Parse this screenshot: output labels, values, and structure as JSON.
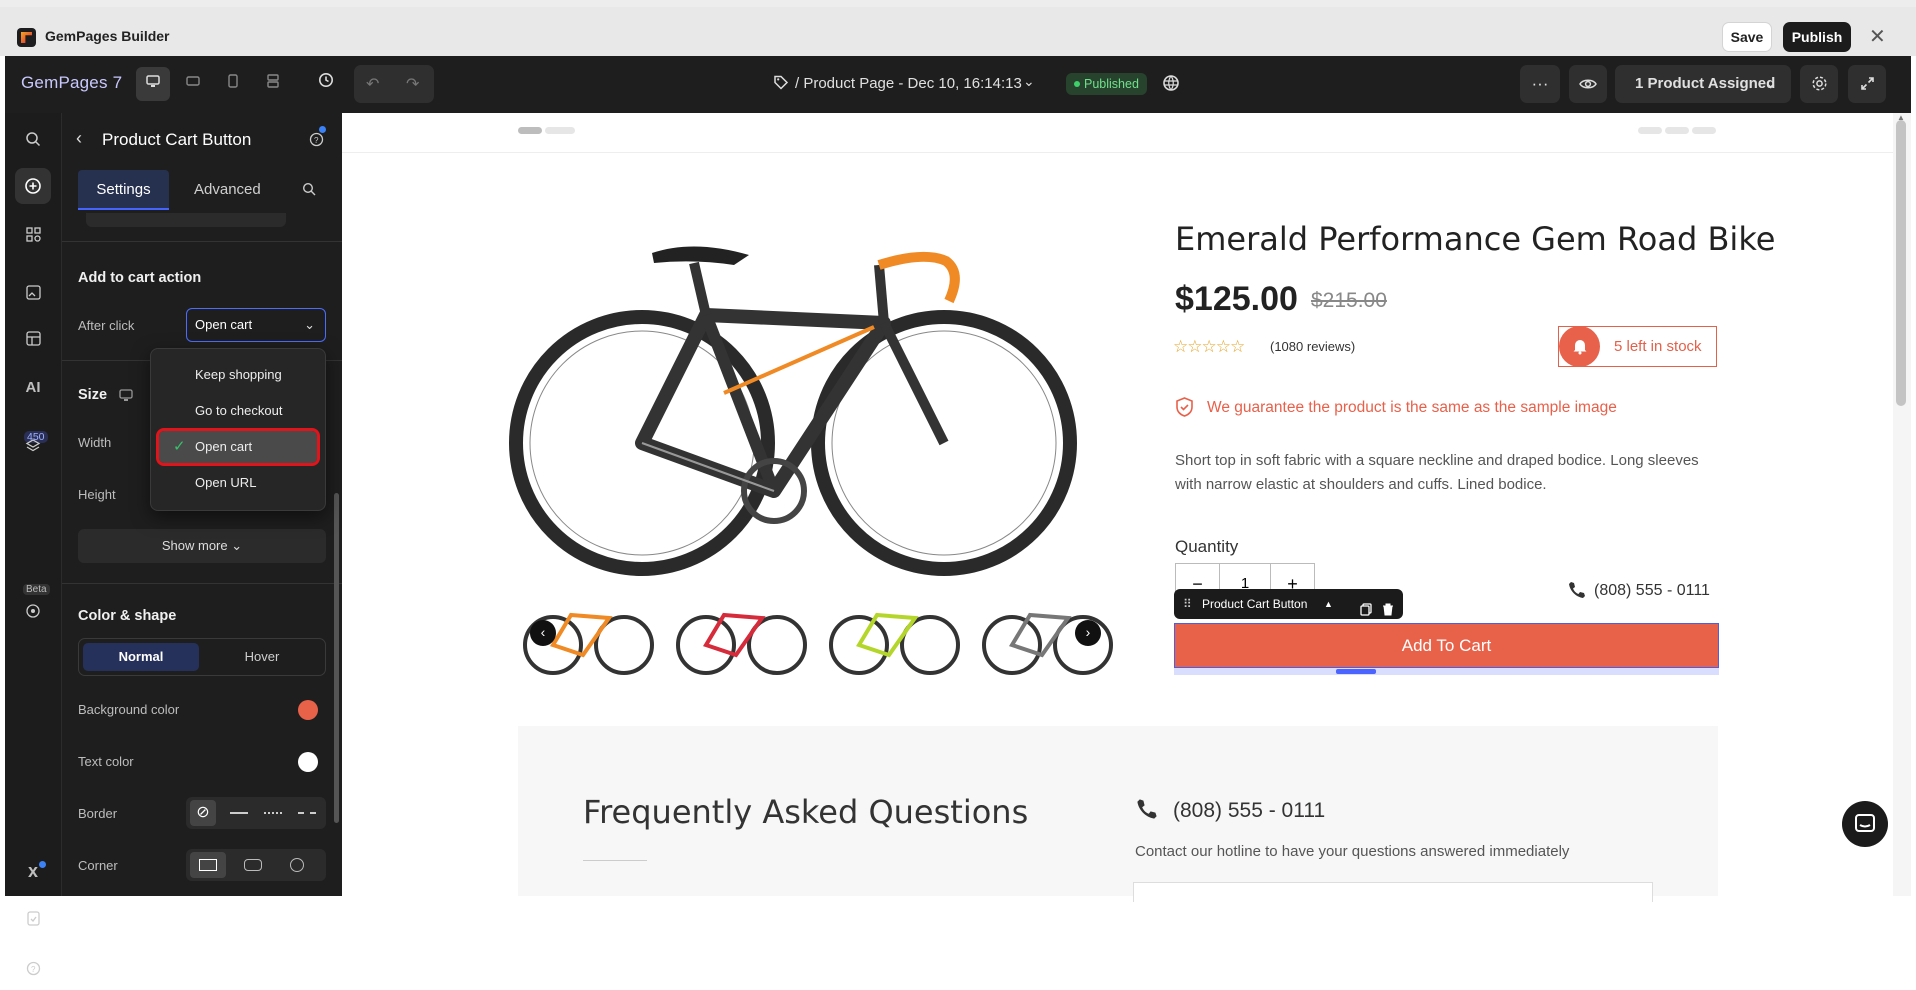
{
  "app": {
    "title": "GemPages Builder",
    "save": "Save",
    "publish": "Publish",
    "close": "✕"
  },
  "toolbar": {
    "brand": "GemPages 7",
    "page_name": "/ Product Page - Dec 10, 16:14:13",
    "status": "Published",
    "assigned": "1 Product Assigned",
    "more": "···"
  },
  "rail": {
    "badge": "450",
    "beta": "Beta",
    "ai": "AI"
  },
  "panel": {
    "title": "Product Cart Button",
    "tabs": [
      "Settings",
      "Advanced"
    ],
    "add_to_cart_heading": "Add to cart action",
    "after_click_label": "After click",
    "after_click_value": "Open cart",
    "size_heading": "Size",
    "width_label": "Width",
    "height_label": "Height",
    "show_more": "Show more",
    "color_shape_heading": "Color & shape",
    "state_normal": "Normal",
    "state_hover": "Hover",
    "bg_color_label": "Background color",
    "bg_color": "#e8624a",
    "text_color_label": "Text color",
    "text_color": "#ffffff",
    "border_label": "Border",
    "corner_label": "Corner"
  },
  "dropdown": {
    "options": [
      "Keep shopping",
      "Go to checkout",
      "Open cart",
      "Open URL"
    ],
    "selected": "Open cart"
  },
  "product": {
    "title": "Emerald Performance Gem Road Bike",
    "price": "$125.00",
    "compare_price": "$215.00",
    "stars": "☆☆☆☆☆",
    "reviews": "(1080 reviews)",
    "stock": "5 left in stock",
    "guarantee": "We guarantee the product is the same as the sample image",
    "description": "Short top in soft fabric with a square neckline and draped bodice. Long sleeves with narrow elastic at shoulders and cuffs. Lined bodice.",
    "quantity_label": "Quantity",
    "quantity": "1",
    "minus": "−",
    "plus": "+",
    "phone": "(808) 555 - 0111",
    "add_to_cart": "Add To Cart",
    "chip_label": "Product Cart Button"
  },
  "faq": {
    "title": "Frequently Asked Questions",
    "phone": "(808) 555 - 0111",
    "hotline": "Contact our hotline to have your questions answered immediately"
  },
  "colors": {
    "accent": "#e8624a",
    "selection": "#4b63ff",
    "annotation": "#e0141a"
  }
}
